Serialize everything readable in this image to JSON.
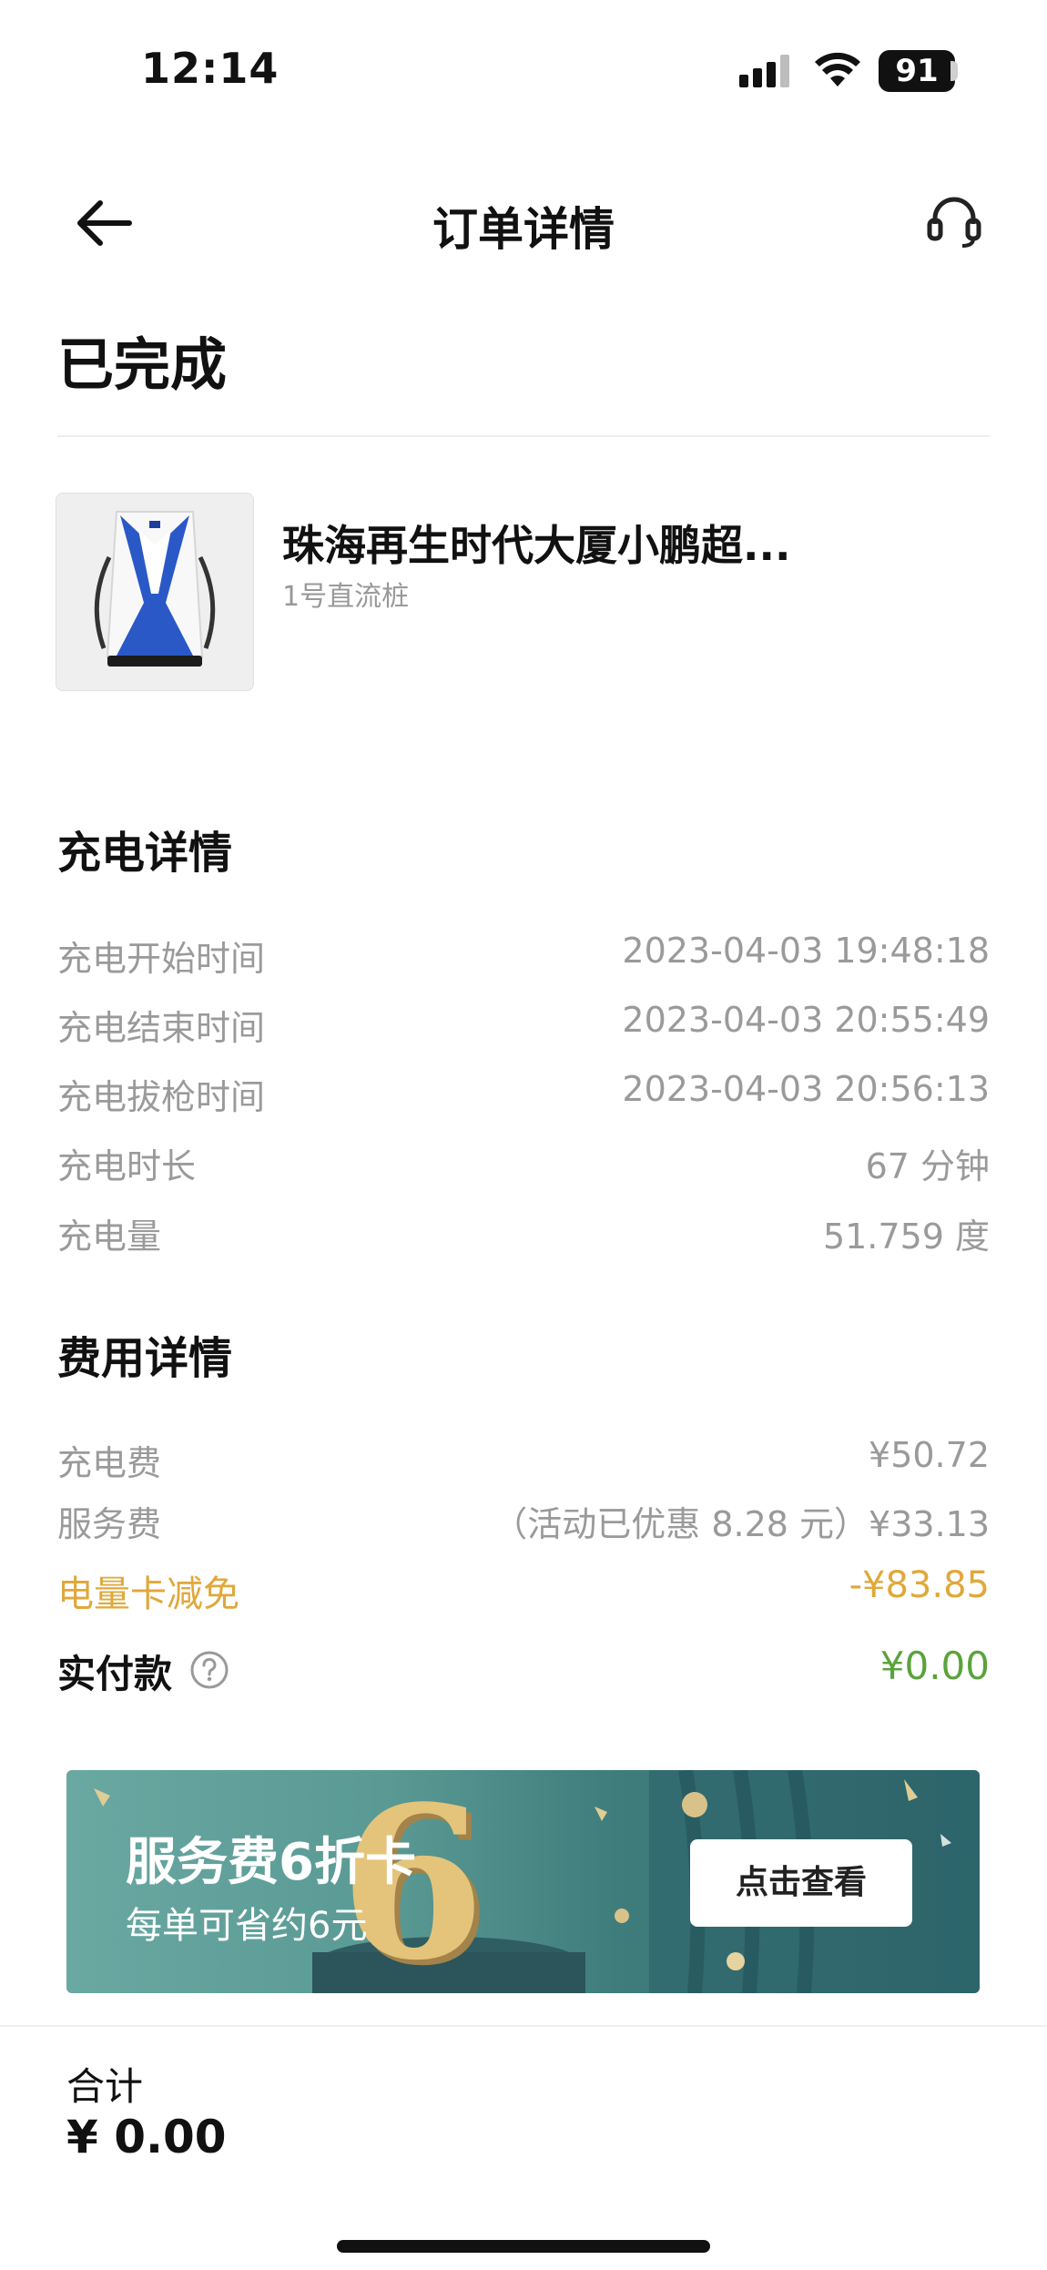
{
  "status_bar": {
    "time": "12:14",
    "battery": "91"
  },
  "nav": {
    "title": "订单详情"
  },
  "order": {
    "status": "已完成"
  },
  "station": {
    "name": "珠海再生时代大厦小鹏超...",
    "pile": "1号直流桩"
  },
  "charging": {
    "title": "充电详情",
    "rows": [
      {
        "label": "充电开始时间",
        "value": "2023-04-03 19:48:18"
      },
      {
        "label": "充电结束时间",
        "value": "2023-04-03 20:55:49"
      },
      {
        "label": "充电拔枪时间",
        "value": "2023-04-03 20:56:13"
      },
      {
        "label": "充电时长",
        "value": "67 分钟"
      },
      {
        "label": "充电量",
        "value": "51.759 度"
      }
    ]
  },
  "fees": {
    "title": "费用详情",
    "rows": [
      {
        "label": "充电费",
        "value": "¥50.72"
      },
      {
        "label": "服务费",
        "value": "（活动已优惠 8.28 元）¥33.13"
      },
      {
        "label": "电量卡减免",
        "value": "-¥83.85"
      }
    ],
    "actual_payment": {
      "label": "实付款",
      "value": "¥0.00"
    }
  },
  "banner": {
    "title": "服务费6折卡",
    "subtitle": "每单可省约6元",
    "big_number": "6",
    "button": "点击查看"
  },
  "footer": {
    "total_label": "合计",
    "total_value": "¥ 0.00"
  },
  "colors": {
    "gold": "#e0a83a",
    "green": "#5aa33c",
    "banner_teal": "#3f7d7c"
  }
}
